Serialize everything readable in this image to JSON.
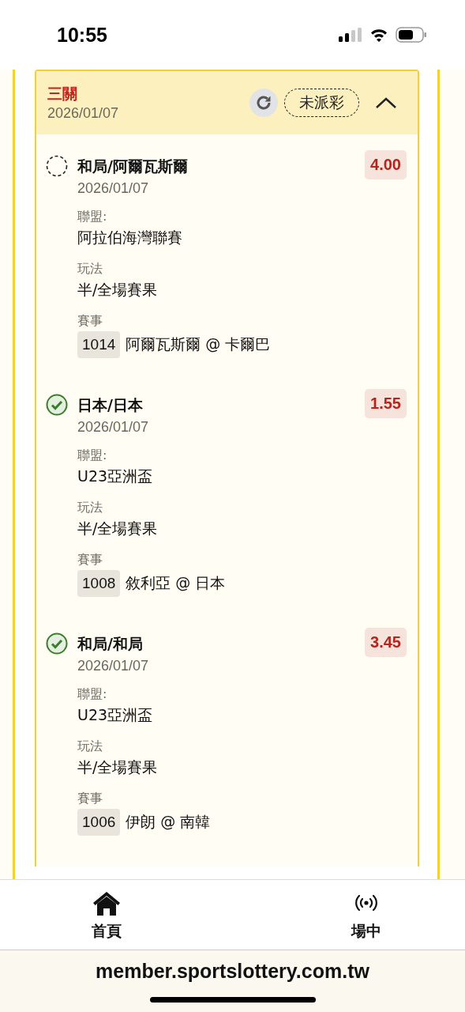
{
  "status_bar": {
    "time": "10:55"
  },
  "ticket": {
    "title": "三關",
    "date": "2026/01/07",
    "status": "未派彩",
    "expanded": true,
    "legs": [
      {
        "kind": "pending",
        "pick": "和局/阿爾瓦斯爾",
        "odds": "4.00",
        "date": "2026/01/07",
        "league_label": "聯盟:",
        "league": "阿拉伯海灣聯賽",
        "bet_type_label": "玩法",
        "bet_type": "半/全場賽果",
        "match_label": "賽事",
        "match_no": "1014",
        "match": "阿爾瓦斯爾 @ 卡爾巴"
      },
      {
        "kind": "won",
        "pick": "日本/日本",
        "odds": "1.55",
        "date": "2026/01/07",
        "league_label": "聯盟:",
        "league": "U23亞洲盃",
        "bet_type_label": "玩法",
        "bet_type": "半/全場賽果",
        "match_label": "賽事",
        "match_no": "1008",
        "match": "敘利亞 @ 日本"
      },
      {
        "kind": "won",
        "pick": "和局/和局",
        "odds": "3.45",
        "date": "2026/01/07",
        "league_label": "聯盟:",
        "league": "U23亞洲盃",
        "bet_type_label": "玩法",
        "bet_type": "半/全場賽果",
        "match_label": "賽事",
        "match_no": "1006",
        "match": "伊朗 @ 南韓"
      }
    ]
  },
  "bottom_nav": [
    {
      "label": "首頁",
      "kind": "home"
    },
    {
      "label": "場中",
      "kind": "live"
    }
  ],
  "url_bar": {
    "url": "member.sportslottery.com.tw"
  }
}
